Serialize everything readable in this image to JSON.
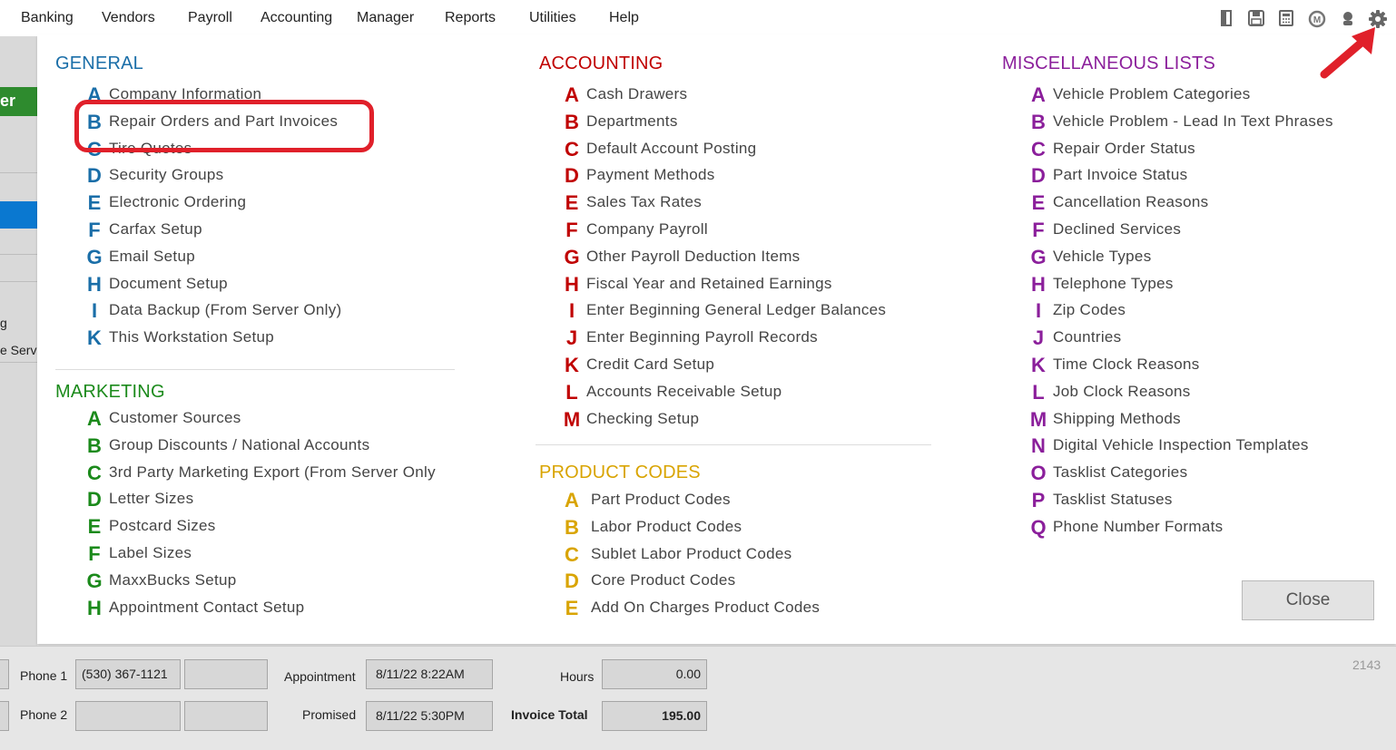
{
  "menubar": {
    "items": [
      "Banking",
      "Vendors",
      "Payroll",
      "Accounting",
      "Manager",
      "Reports",
      "Utilities",
      "Help"
    ],
    "icons": [
      "door-icon",
      "save-icon",
      "calculator-icon",
      "logo-icon",
      "support-icon",
      "gear-icon"
    ]
  },
  "left_strip": {
    "texts": [
      "er",
      "g",
      "e Servi"
    ]
  },
  "general": {
    "title": "GENERAL",
    "items": [
      {
        "letter": "A",
        "label": "Company Information"
      },
      {
        "letter": "B",
        "label": "Repair Orders and Part Invoices"
      },
      {
        "letter": "C",
        "label": "Tire Quotes"
      },
      {
        "letter": "D",
        "label": "Security Groups"
      },
      {
        "letter": "E",
        "label": "Electronic Ordering"
      },
      {
        "letter": "F",
        "label": "Carfax Setup"
      },
      {
        "letter": "G",
        "label": "Email Setup"
      },
      {
        "letter": "H",
        "label": "Document Setup"
      },
      {
        "letter": "I",
        "label": "Data Backup (From Server Only)"
      },
      {
        "letter": "K",
        "label": "This Workstation Setup"
      }
    ]
  },
  "marketing": {
    "title": "MARKETING",
    "items": [
      {
        "letter": "A",
        "label": "Customer Sources"
      },
      {
        "letter": "B",
        "label": "Group Discounts / National Accounts"
      },
      {
        "letter": "C",
        "label": "3rd Party Marketing Export (From Server Only"
      },
      {
        "letter": "D",
        "label": "Letter Sizes"
      },
      {
        "letter": "E",
        "label": "Postcard Sizes"
      },
      {
        "letter": "F",
        "label": "Label Sizes"
      },
      {
        "letter": "G",
        "label": "MaxxBucks Setup"
      },
      {
        "letter": "H",
        "label": "Appointment Contact Setup"
      }
    ]
  },
  "accounting": {
    "title": "ACCOUNTING",
    "items": [
      {
        "letter": "A",
        "label": "Cash Drawers"
      },
      {
        "letter": "B",
        "label": "Departments"
      },
      {
        "letter": "C",
        "label": "Default Account Posting"
      },
      {
        "letter": "D",
        "label": "Payment Methods"
      },
      {
        "letter": "E",
        "label": "Sales Tax Rates"
      },
      {
        "letter": "F",
        "label": "Company Payroll"
      },
      {
        "letter": "G",
        "label": "Other Payroll Deduction Items"
      },
      {
        "letter": "H",
        "label": "Fiscal Year and Retained Earnings"
      },
      {
        "letter": "I",
        "label": "Enter Beginning General Ledger Balances"
      },
      {
        "letter": "J",
        "label": "Enter Beginning Payroll Records"
      },
      {
        "letter": "K",
        "label": "Credit Card Setup"
      },
      {
        "letter": "L",
        "label": "Accounts Receivable Setup"
      },
      {
        "letter": "M",
        "label": "Checking Setup"
      }
    ]
  },
  "product_codes": {
    "title": "PRODUCT CODES",
    "items": [
      {
        "letter": "A",
        "label": "Part Product Codes"
      },
      {
        "letter": "B",
        "label": "Labor Product Codes"
      },
      {
        "letter": "C",
        "label": "Sublet Labor Product Codes"
      },
      {
        "letter": "D",
        "label": "Core Product Codes"
      },
      {
        "letter": "E",
        "label": "Add On Charges Product Codes"
      }
    ]
  },
  "misc": {
    "title": "MISCELLANEOUS LISTS",
    "items": [
      {
        "letter": "A",
        "label": "Vehicle Problem Categories"
      },
      {
        "letter": "B",
        "label": "Vehicle Problem - Lead In Text Phrases"
      },
      {
        "letter": "C",
        "label": "Repair Order Status"
      },
      {
        "letter": "D",
        "label": "Part Invoice Status"
      },
      {
        "letter": "E",
        "label": "Cancellation Reasons"
      },
      {
        "letter": "F",
        "label": "Declined Services"
      },
      {
        "letter": "G",
        "label": "Vehicle Types"
      },
      {
        "letter": "H",
        "label": "Telephone Types"
      },
      {
        "letter": "I",
        "label": "Zip Codes"
      },
      {
        "letter": "J",
        "label": "Countries"
      },
      {
        "letter": "K",
        "label": "Time Clock Reasons"
      },
      {
        "letter": "L",
        "label": "Job Clock Reasons"
      },
      {
        "letter": "M",
        "label": "Shipping Methods"
      },
      {
        "letter": "N",
        "label": "Digital Vehicle Inspection Templates"
      },
      {
        "letter": "O",
        "label": "Tasklist Categories"
      },
      {
        "letter": "P",
        "label": "Tasklist Statuses"
      },
      {
        "letter": "Q",
        "label": "Phone Number Formats"
      }
    ]
  },
  "close_label": "Close",
  "bottom": {
    "phone1_label": "Phone 1",
    "phone1_value": "(530) 367-1121",
    "phone2_label": "Phone 2",
    "appointment_label": "Appointment",
    "appointment_value": "8/11/22  8:22AM",
    "promised_label": "Promised",
    "promised_value": "8/11/22  5:30PM",
    "hours_label": "Hours",
    "hours_value": "0.00",
    "invoice_total_label": "Invoice Total",
    "invoice_total_value": "195.00",
    "record_number": "2143"
  },
  "colors": {
    "general": "#1a6ea8",
    "accounting": "#c00000",
    "marketing": "#1b8a1b",
    "product_codes": "#d9a400",
    "misc": "#8b1f9b",
    "highlight": "#e0202a"
  }
}
